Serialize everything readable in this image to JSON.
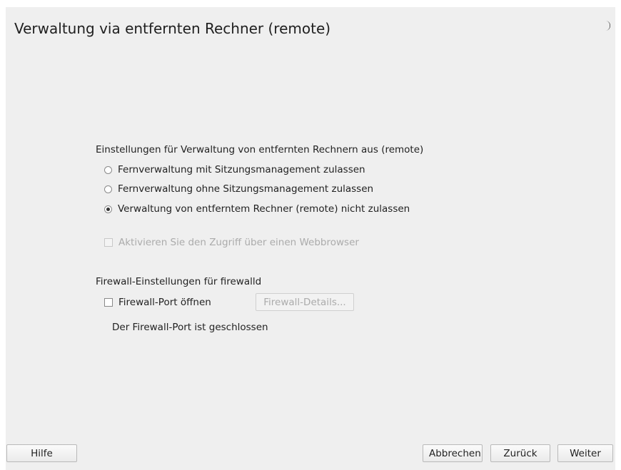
{
  "dialog": {
    "title": "Verwaltung via entfernten Rechner (remote)",
    "theme_icon": "moon-icon"
  },
  "remote_settings": {
    "label": "Einstellungen für Verwaltung von entfernten Rechnern aus (remote)",
    "options": [
      {
        "label": "Fernverwaltung mit Sitzungsmanagement zulassen",
        "selected": false
      },
      {
        "label": "Fernverwaltung ohne Sitzungsmanagement zulassen",
        "selected": false
      },
      {
        "label": "Verwaltung von entferntem Rechner (remote) nicht zulassen",
        "selected": true
      }
    ],
    "webbrowser_access": {
      "label": "Aktivieren Sie den Zugriff über einen Webbrowser",
      "checked": false,
      "enabled": false
    }
  },
  "firewall": {
    "label": "Firewall-Einstellungen für firewalld",
    "open_port": {
      "label": "Firewall-Port öffnen",
      "checked": false
    },
    "details_button": "Firewall-Details...",
    "status": "Der Firewall-Port ist geschlossen"
  },
  "footer": {
    "help": "Hilfe",
    "cancel": "Abbrechen",
    "back": "Zurück",
    "next": "Weiter"
  }
}
